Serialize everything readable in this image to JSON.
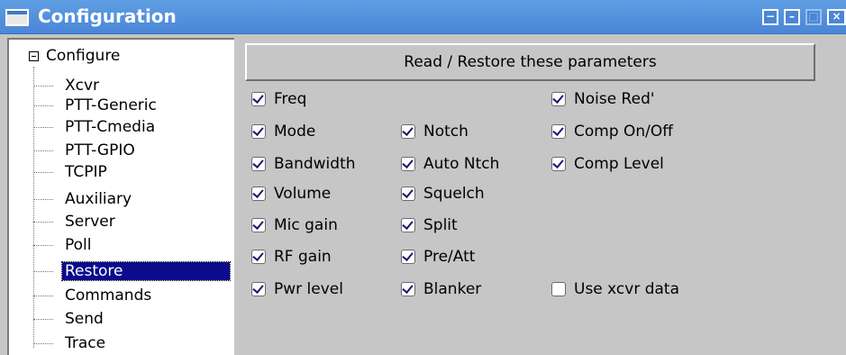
{
  "window": {
    "title": "Configuration",
    "controls": [
      "−",
      "–",
      "□",
      "×"
    ]
  },
  "tree": {
    "root_label": "Configure",
    "items": [
      {
        "label": "Xcvr",
        "selected": false
      },
      {
        "label": "PTT-Generic",
        "selected": false
      },
      {
        "label": "PTT-Cmedia",
        "selected": false
      },
      {
        "label": "PTT-GPIO",
        "selected": false
      },
      {
        "label": "TCPIP",
        "selected": false
      },
      {
        "label": "Auxiliary",
        "selected": false
      },
      {
        "label": "Server",
        "selected": false
      },
      {
        "label": "Poll",
        "selected": false
      },
      {
        "label": "Restore",
        "selected": true
      },
      {
        "label": "Commands",
        "selected": false
      },
      {
        "label": "Send",
        "selected": false
      },
      {
        "label": "Trace",
        "selected": false
      }
    ]
  },
  "restore": {
    "header": "Read / Restore these parameters",
    "col1": [
      {
        "label": "Freq",
        "checked": true
      },
      {
        "label": "Mode",
        "checked": true
      },
      {
        "label": "Bandwidth",
        "checked": true
      },
      {
        "label": "Volume",
        "checked": true
      },
      {
        "label": "Mic gain",
        "checked": true
      },
      {
        "label": "RF gain",
        "checked": true
      },
      {
        "label": "Pwr level",
        "checked": true
      }
    ],
    "col2": [
      {
        "label": "Notch",
        "checked": true
      },
      {
        "label": "Auto Ntch",
        "checked": true
      },
      {
        "label": "Squelch",
        "checked": true
      },
      {
        "label": "Split",
        "checked": true
      },
      {
        "label": "Pre/Att",
        "checked": true
      },
      {
        "label": "Blanker",
        "checked": true
      }
    ],
    "col3": [
      {
        "label": "Noise Red'",
        "checked": true
      },
      {
        "label": "Comp On/Off",
        "checked": true
      },
      {
        "label": "Comp Level",
        "checked": true
      },
      {
        "label": "Use xcvr data",
        "checked": false
      }
    ]
  },
  "colors": {
    "titlebar": "#4a86d6",
    "selection": "#0b0b8c",
    "background": "#c6c6c6"
  }
}
